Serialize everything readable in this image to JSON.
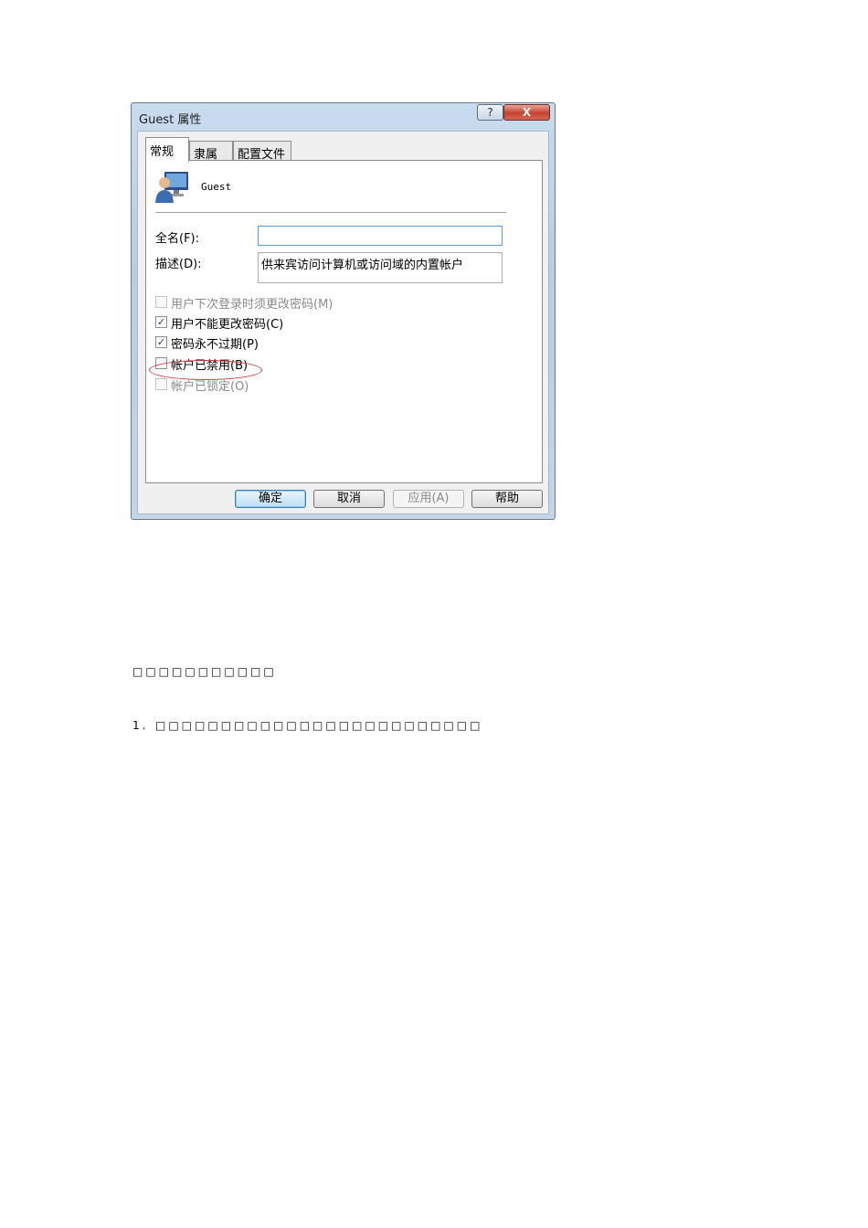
{
  "dialog": {
    "title": "Guest 属性",
    "help_glyph": "?",
    "close_glyph": "X",
    "tabs": [
      "常规",
      "隶属于",
      "配置文件"
    ],
    "username": "Guest",
    "fullname_label": "全名(F):",
    "fullname_value": "",
    "description_label": "描述(D):",
    "description_value": "供来宾访问计算机或访问域的内置帐户",
    "checkboxes": [
      {
        "label": "用户下次登录时须更改密码(M)",
        "checked": false,
        "enabled": false
      },
      {
        "label": "用户不能更改密码(C)",
        "checked": true,
        "enabled": true
      },
      {
        "label": "密码永不过期(P)",
        "checked": true,
        "enabled": true
      },
      {
        "label": "帐户已禁用(B)",
        "checked": false,
        "enabled": true
      },
      {
        "label": "帐户已锁定(O)",
        "checked": false,
        "enabled": false
      }
    ],
    "buttons": {
      "ok": "确定",
      "cancel": "取消",
      "apply": "应用(A)",
      "help": "帮助"
    },
    "check_glyph": "✓",
    "colors": {
      "highlight_oval": "#d23a3a",
      "close_button": "#c6422f"
    }
  },
  "document": {
    "line1": "□□□□□□□□□□□",
    "line2_number": "1.",
    "line2": "□□□□□□□□□□□□□□□□□□□□□□□□□"
  }
}
